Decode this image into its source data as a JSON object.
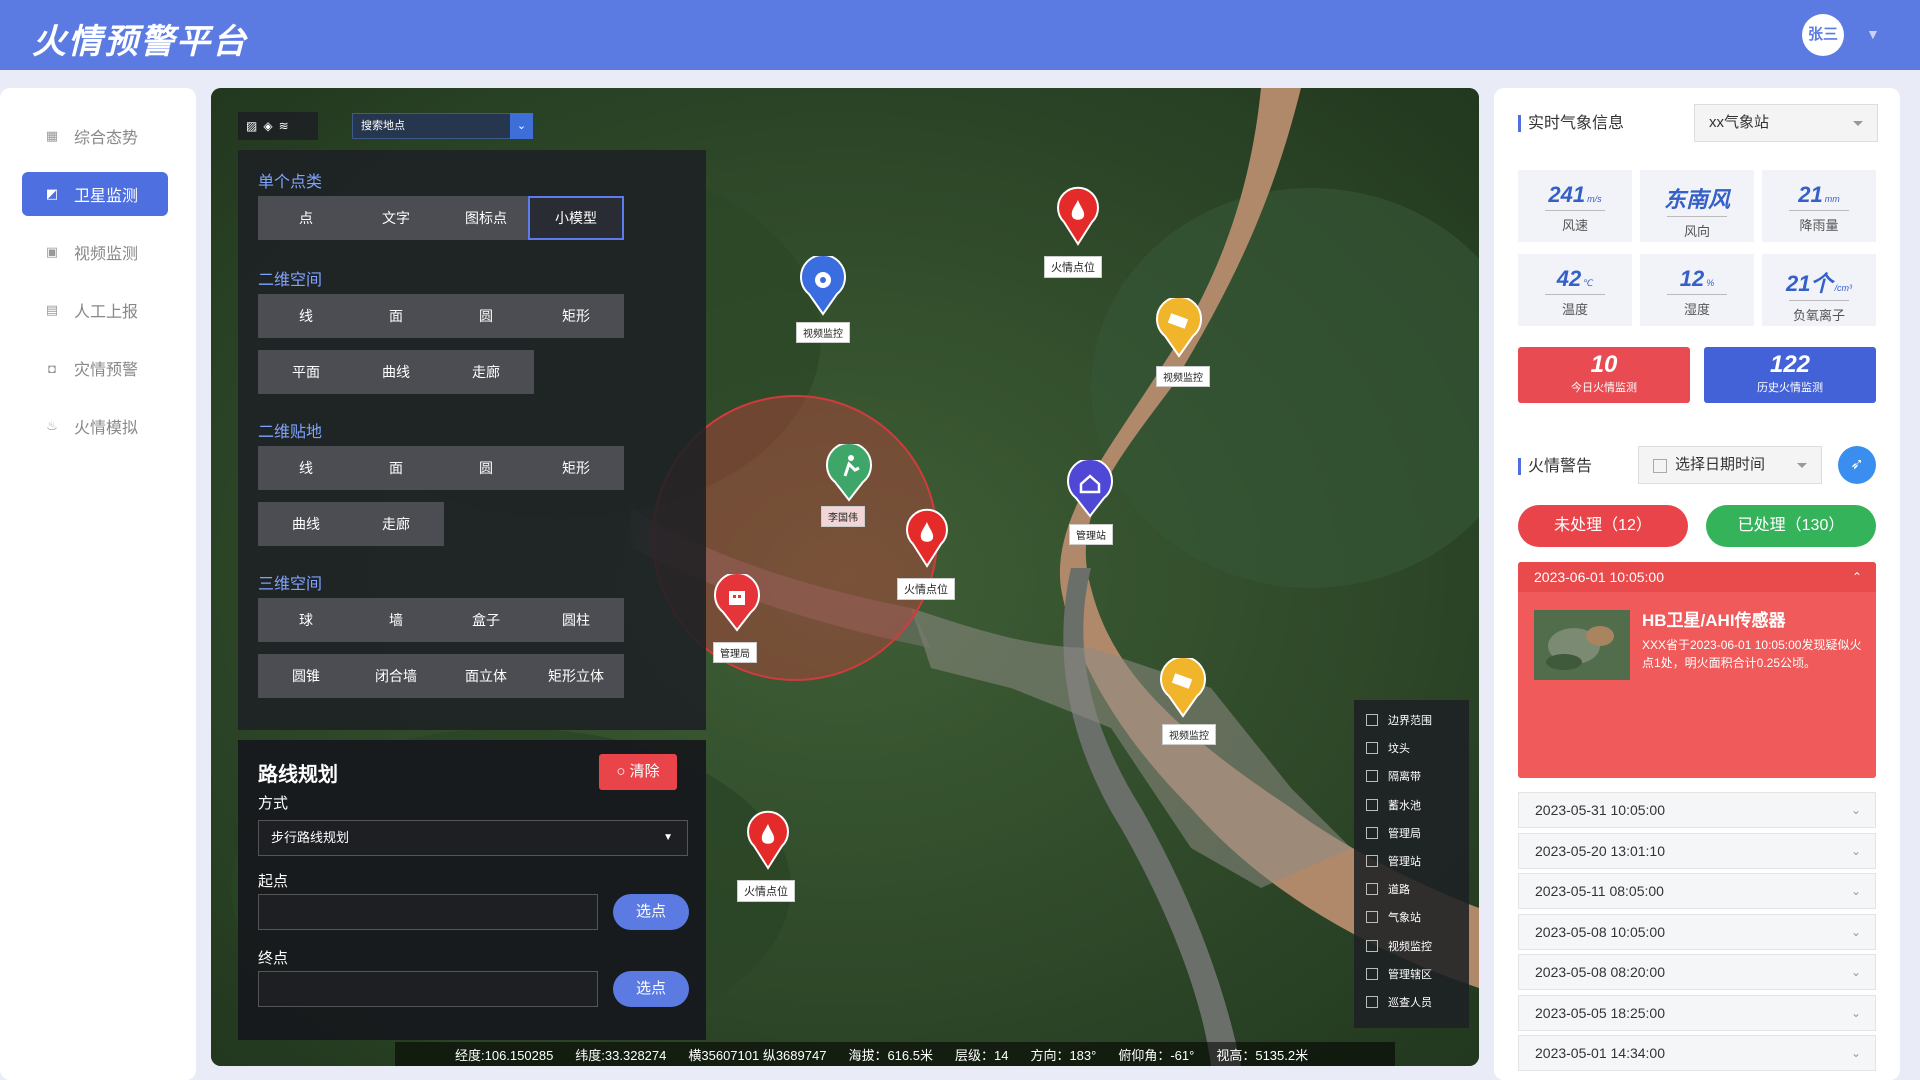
{
  "app": {
    "title": "火情预警平台",
    "user": "张三"
  },
  "sidebar": {
    "items": [
      {
        "label": "综合态势",
        "icon": "grid-icon"
      },
      {
        "label": "卫星监测",
        "icon": "satellite-icon",
        "active": true
      },
      {
        "label": "视频监测",
        "icon": "video-icon"
      },
      {
        "label": "人工上报",
        "icon": "report-icon"
      },
      {
        "label": "灾情预警",
        "icon": "warning-icon"
      },
      {
        "label": "火情模拟",
        "icon": "fire-icon"
      }
    ]
  },
  "map": {
    "search_placeholder": "搜索地点",
    "panel": {
      "sections": [
        {
          "title": "单个点类",
          "buttons": [
            "点",
            "文字",
            "图标点",
            "小模型"
          ]
        },
        {
          "title": "二维空间",
          "buttons": [
            "线",
            "面",
            "圆",
            "矩形",
            "平面",
            "曲线",
            "走廊"
          ]
        },
        {
          "title": "二维贴地",
          "buttons": [
            "线",
            "面",
            "圆",
            "矩形",
            "曲线",
            "走廊"
          ]
        },
        {
          "title": "三维空间",
          "buttons": [
            "球",
            "墙",
            "盒子",
            "圆柱",
            "圆锥",
            "闭合墙",
            "面立体",
            "矩形立体"
          ]
        }
      ]
    },
    "route": {
      "title": "路线规划",
      "clear": "清除",
      "mode_label": "方式",
      "mode_value": "步行路线规划",
      "start_label": "起点",
      "end_label": "终点",
      "pick": "选点"
    },
    "markers": [
      {
        "label": "火情点位",
        "type": "fire"
      },
      {
        "label": "视频监控",
        "type": "camera-blue"
      },
      {
        "label": "视频监控",
        "type": "camera-yellow"
      },
      {
        "label": "李国伟",
        "type": "person"
      },
      {
        "label": "火情点位",
        "type": "fire"
      },
      {
        "label": "管理站",
        "type": "station"
      },
      {
        "label": "管理局",
        "type": "bureau"
      },
      {
        "label": "视频监控",
        "type": "camera-yellow"
      },
      {
        "label": "火情点位",
        "type": "fire"
      }
    ],
    "layers": [
      "边界范围",
      "坟头",
      "隔离带",
      "蓄水池",
      "管理局",
      "管理站",
      "道路",
      "气象站",
      "视频监控",
      "管理辖区",
      "巡查人员"
    ],
    "status": {
      "lon": "经度:106.150285",
      "lat": "纬度:33.328274",
      "xy": "横35607101 纵3689747",
      "alt": "海拔：616.5米",
      "level": "层级：14",
      "dir": "方向：183°",
      "pitch": "俯仰角：-61°",
      "view": "视高：5135.2米"
    }
  },
  "weather": {
    "title": "实时气象信息",
    "station": "xx气象站",
    "cards": [
      {
        "value": "241",
        "unit": "m/s",
        "name": "风速"
      },
      {
        "value": "东南风",
        "unit": "",
        "name": "风向"
      },
      {
        "value": "21",
        "unit": "mm",
        "name": "降雨量"
      },
      {
        "value": "42",
        "unit": "℃",
        "name": "温度"
      },
      {
        "value": "12",
        "unit": "%",
        "name": "湿度"
      },
      {
        "value": "21个",
        "unit": "/cm³",
        "name": "负氧离子"
      }
    ],
    "today": {
      "value": "10",
      "name": "今日火情监测"
    },
    "history": {
      "value": "122",
      "name": "历史火情监测"
    }
  },
  "alerts": {
    "title": "火情警告",
    "date_placeholder": "选择日期时间",
    "pending": "未处理（12）",
    "done": "已处理（130）",
    "active": {
      "time": "2023-06-01 10:05:00",
      "source": "HB卫星/AHI传感器",
      "text": "XXX省于2023-06-01  10:05:00发现疑似火点1处，明火面积合计0.25公顷。"
    },
    "list": [
      "2023-05-31 10:05:00",
      "2023-05-20 13:01:10",
      "2023-05-11 08:05:00",
      "2023-05-08 10:05:00",
      "2023-05-08 08:20:00",
      "2023-05-05 18:25:00",
      "2023-05-01 14:34:00"
    ]
  },
  "colors": {
    "brand": "#5b7be3",
    "danger": "#e8444a",
    "success": "#34b35a",
    "stat_today": "#e84b52",
    "stat_history": "#4462d8"
  }
}
